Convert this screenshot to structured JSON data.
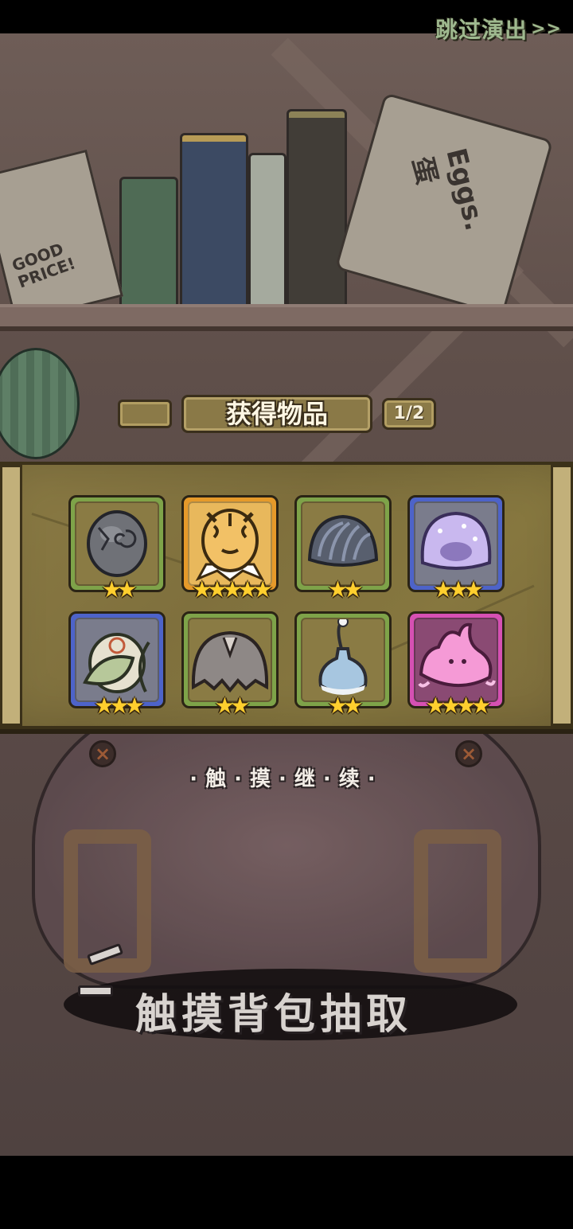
{
  "top_bar": {
    "skip_label": "跳过演出",
    "skip_arrows": ">>"
  },
  "background": {
    "poster_left_text": "GOOD PRICE!",
    "poster_right_text": "Eggs. 蛋",
    "touch_bag_label": "触摸背包抽取"
  },
  "reward_panel": {
    "title": "获得物品",
    "page_counter": "1/2",
    "items": [
      {
        "icon": "cracked-stone-egg-icon",
        "rarity_color": "green",
        "stars": 2
      },
      {
        "icon": "tiger-egg-icon",
        "rarity_color": "orange",
        "stars": 5
      },
      {
        "icon": "grey-shell-egg-icon",
        "rarity_color": "green",
        "stars": 2
      },
      {
        "icon": "purple-jelly-egg-icon",
        "rarity_color": "blue",
        "stars": 3
      },
      {
        "icon": "leaf-wrapped-egg-icon",
        "rarity_color": "blue",
        "stars": 3
      },
      {
        "icon": "furry-grey-egg-icon",
        "rarity_color": "green",
        "stars": 2
      },
      {
        "icon": "blue-vase-egg-icon",
        "rarity_color": "green",
        "stars": 2
      },
      {
        "icon": "pink-slime-egg-icon",
        "rarity_color": "pink",
        "stars": 4
      }
    ],
    "continue_hint": "·触·摸·继·续·"
  },
  "colors": {
    "green": "#7ea349",
    "blue": "#4d63c9",
    "orange": "#e69a2a",
    "pink": "#d650b3",
    "star": "#ffcf2e",
    "skip_text": "#9fb98f"
  }
}
